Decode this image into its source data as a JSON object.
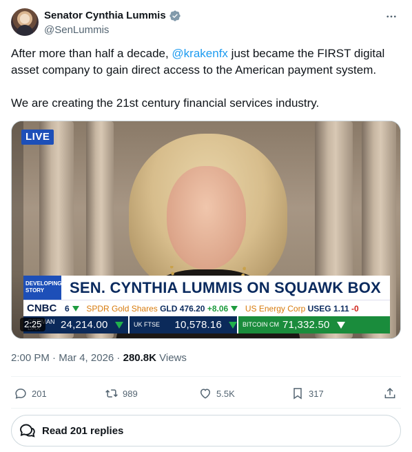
{
  "author": {
    "display_name": "Senator Cynthia Lummis",
    "handle": "@SenLummis"
  },
  "tweet": {
    "line1_before": "After more than half a decade, ",
    "mention": "@krakenfx",
    "line1_after": " just became the FIRST digital asset company to gain direct access to the American payment system.",
    "paragraph2": "We are creating the 21st century financial services industry."
  },
  "video": {
    "live_label": "LIVE",
    "duration": "2:25",
    "developing_story": "DEVELOPING STORY",
    "headline": "SEN. CYNTHIA LUMMIS ON SQUAWK BOX",
    "network": "CNBC",
    "ticker_top": {
      "partial": "6",
      "spdr_name": "SPDR Gold Shares",
      "spdr_symbol": "GLD",
      "spdr_price": "476.20",
      "spdr_change": "+8.06",
      "useg_name": "US Energy Corp",
      "useg_symbol": "USEG",
      "useg_price": "1.11",
      "useg_change": "-0"
    },
    "ticker_bottom": [
      {
        "label": "GERMAN DAX",
        "value": "24,214.00"
      },
      {
        "label": "UK FTSE",
        "value": "10,578.16"
      },
      {
        "label": "BITCOIN CM",
        "value": "71,332.50"
      }
    ]
  },
  "meta": {
    "time": "2:00 PM",
    "separator": " · ",
    "date": "Mar 4, 2026",
    "views_count": "280.8K",
    "views_label": " Views"
  },
  "actions": {
    "replies": "201",
    "reposts": "989",
    "likes": "5.5K",
    "bookmarks": "317"
  },
  "read_replies_label": "Read 201 replies",
  "colors": {
    "accent": "#1d9bf0",
    "text": "#0f1419",
    "muted": "#536471",
    "border": "#cfd9de",
    "verified": "#829aab"
  }
}
